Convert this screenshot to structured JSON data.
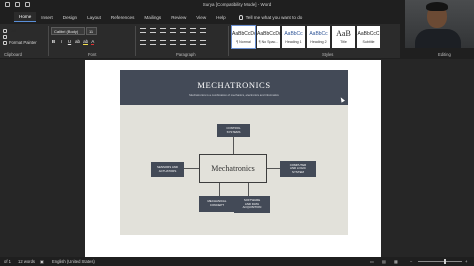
{
  "window": {
    "title": "Surya [Compatibility Mode]  -  Word"
  },
  "tabs": [
    "Home",
    "Insert",
    "Design",
    "Layout",
    "References",
    "Mailings",
    "Review",
    "View",
    "Help"
  ],
  "tell_me": "Tell me what you want to do",
  "clipboard": {
    "cut": "Cut",
    "copy": "Copy",
    "format_painter": "Format Painter",
    "label": "Clipboard"
  },
  "font": {
    "name": "Calibri (Body)",
    "size": "11",
    "label": "Font"
  },
  "paragraph": {
    "label": "Paragraph"
  },
  "styles": {
    "label": "Styles",
    "items": [
      {
        "sample": "AaBbCcDc",
        "name": "¶ Normal"
      },
      {
        "sample": "AaBbCcDc",
        "name": "¶ No Spac..."
      },
      {
        "sample": "AaBbCc",
        "name": "Heading 1"
      },
      {
        "sample": "AaBbCc",
        "name": "Heading 2"
      },
      {
        "sample": "AaB",
        "name": "Title"
      },
      {
        "sample": "AaBbCcC",
        "name": "Subtitle"
      }
    ]
  },
  "editing": {
    "label": "Editing"
  },
  "slide": {
    "title": "MECHATRONICS",
    "subtitle": "Mechatronics is a combination of mechanics, electronics and informatics",
    "center": "Mechatronics",
    "nodes": {
      "top": "CONTROL\nSYSTEMS",
      "left": "SENSORS AND\nACTUATORS",
      "right": "COMPUTER\nAND LOGIC\nSYSTEM",
      "bottom_left": "MECHANICAL\nCONCEPT",
      "bottom_right": "SOFTWARE\nAND DATA\nACQUISITION"
    }
  },
  "status": {
    "page": "of 1",
    "words": "12 words",
    "language": "English (United States)"
  },
  "colors": {
    "ribbon": "#2b2b2b",
    "slide_header": "#434a57",
    "slide_bg": "#e2e1da"
  }
}
